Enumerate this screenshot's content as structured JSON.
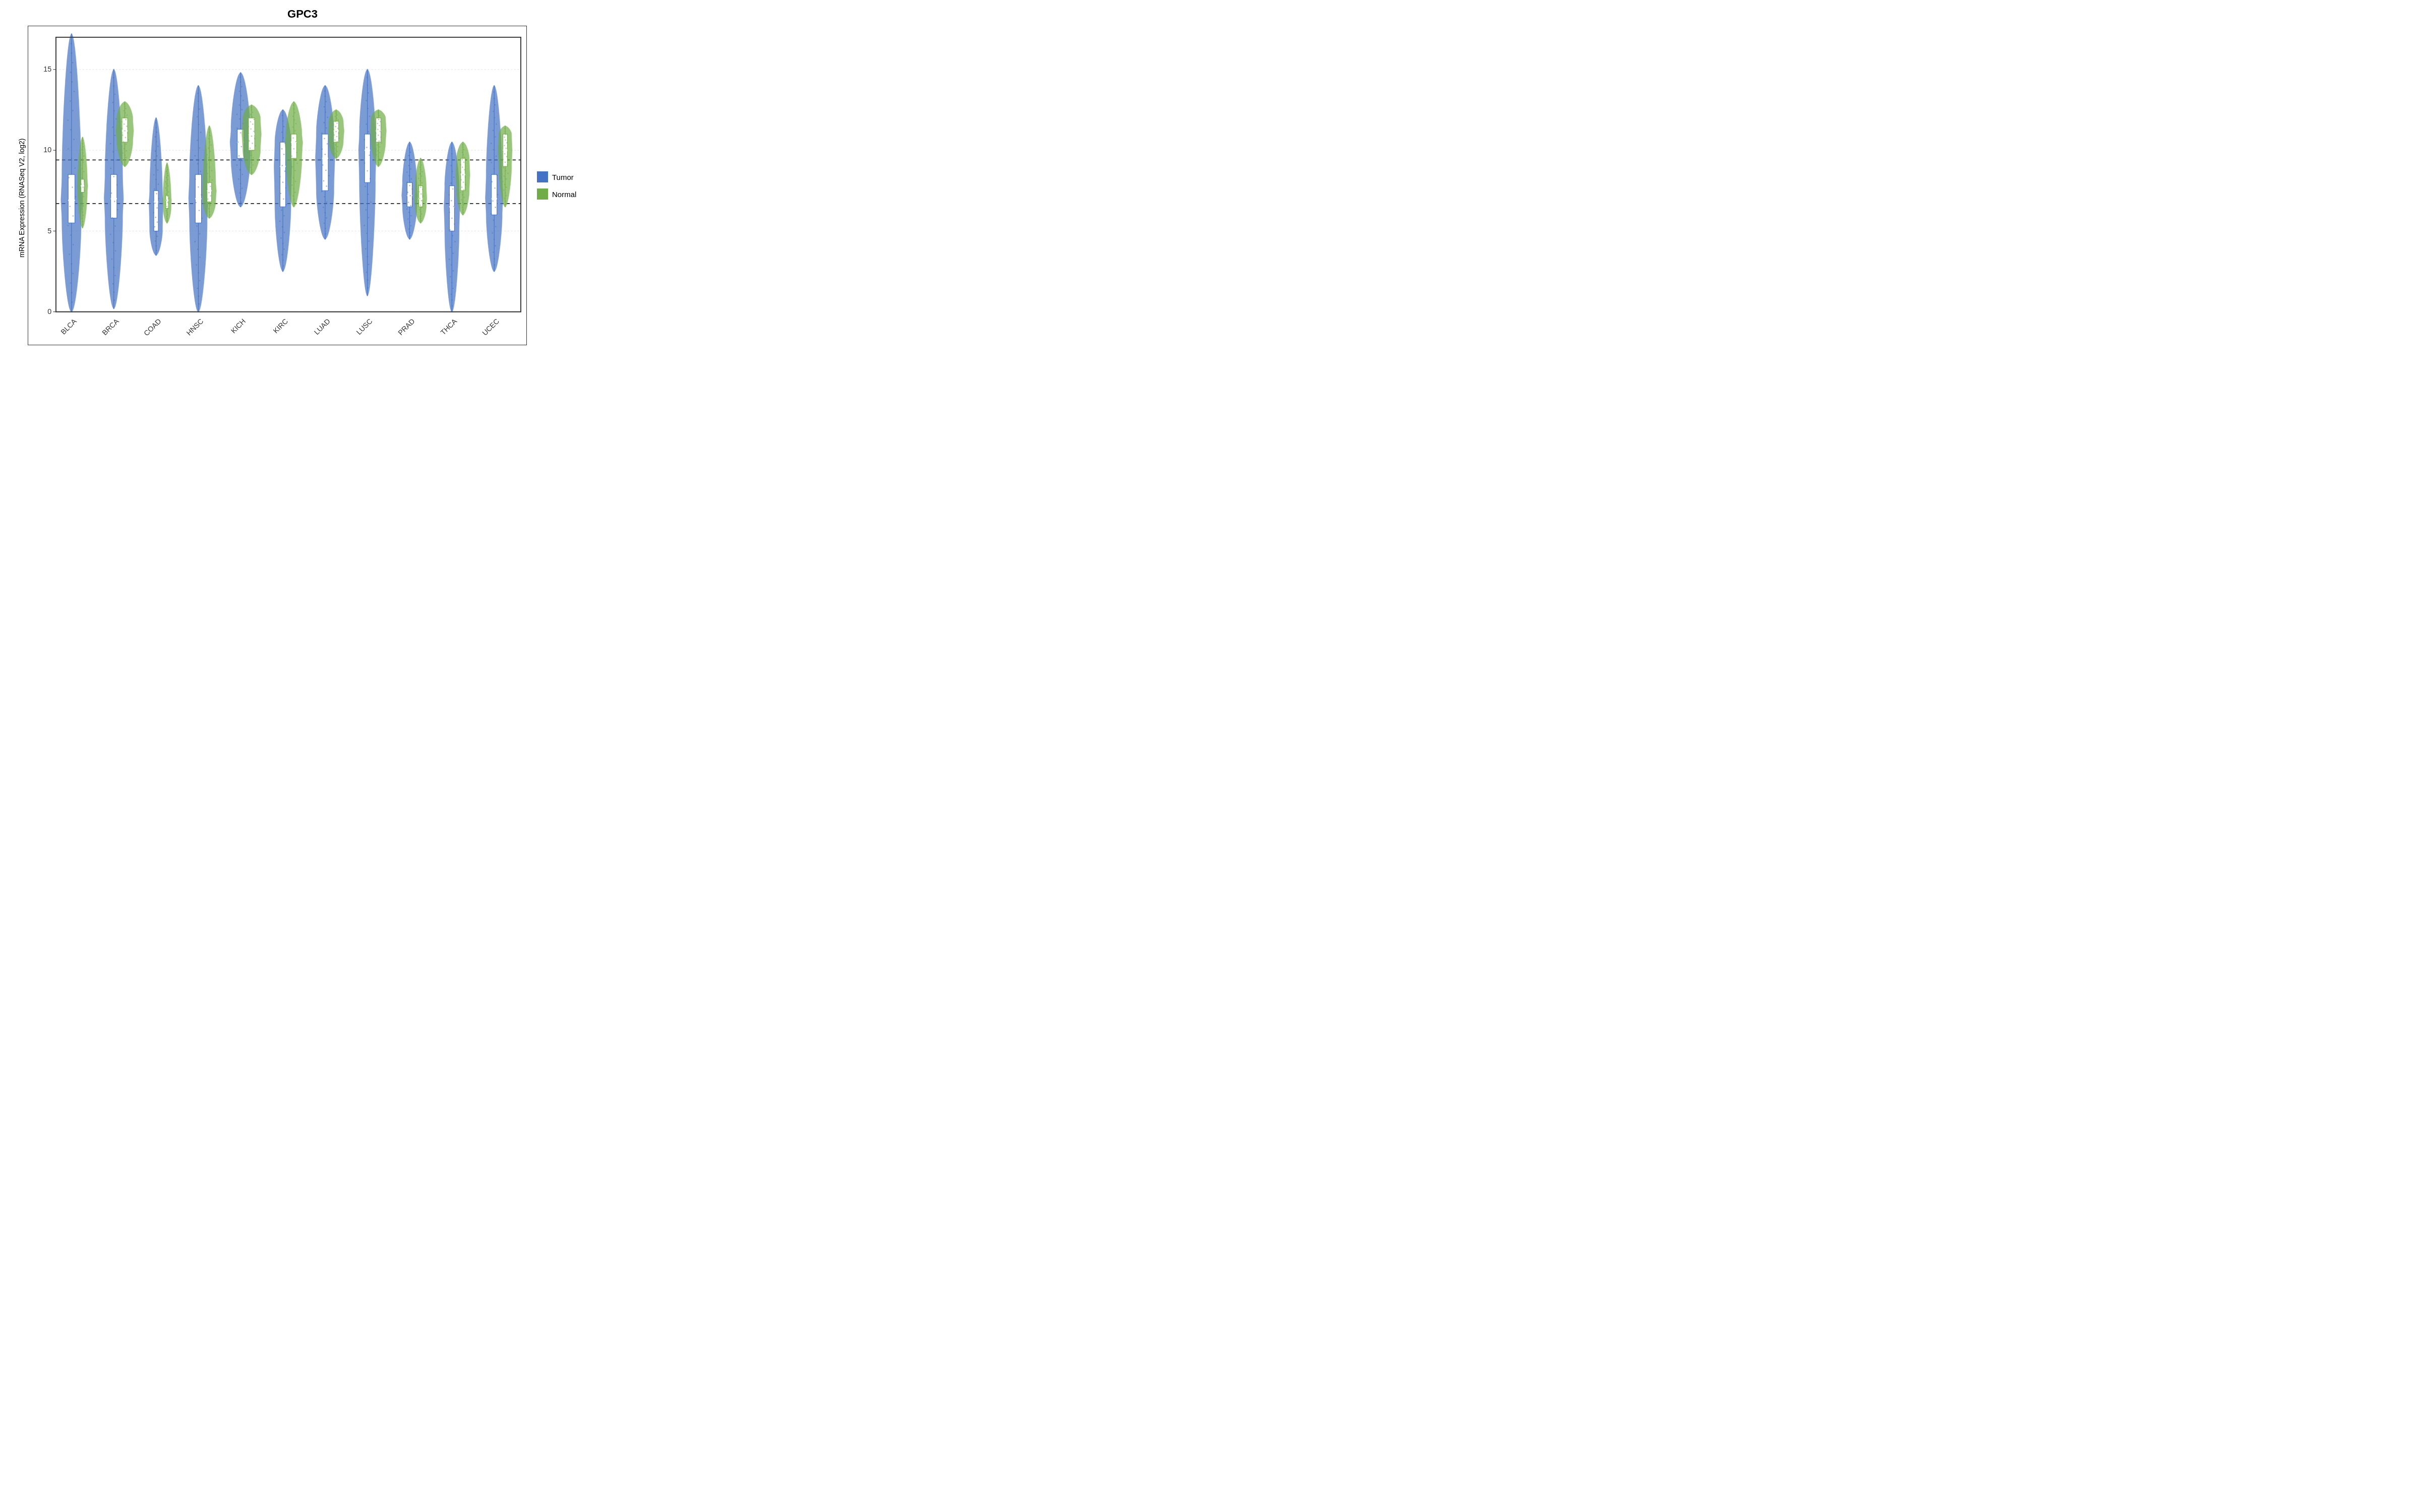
{
  "title": "GPC3",
  "yAxisLabel": "mRNA Expression (RNASeq V2, log2)",
  "yTicks": [
    0,
    5,
    10,
    15
  ],
  "dottedLines": [
    6.7,
    9.4
  ],
  "legend": {
    "items": [
      {
        "label": "Tumor",
        "color": "#4472C4"
      },
      {
        "label": "Normal",
        "color": "#70AD47"
      }
    ]
  },
  "cancerTypes": [
    "BLCA",
    "BRCA",
    "COAD",
    "HNSC",
    "KICH",
    "KIRC",
    "LUAD",
    "LUSC",
    "PRAD",
    "THCA",
    "UCEC"
  ],
  "violins": [
    {
      "type": "BLCA",
      "tumor": {
        "min": 0,
        "q1": 5.5,
        "median": 6.9,
        "q3": 8.5,
        "max": 17.2,
        "width": 0.6,
        "topOutliers": [
          13,
          12.5,
          12,
          11.5
        ],
        "bottomOutliers": [
          0,
          0.5,
          1,
          1.5,
          2,
          2.5
        ]
      },
      "normal": {
        "min": 5.2,
        "q1": 7.4,
        "median": 7.8,
        "q3": 8.2,
        "max": 10.8,
        "width": 0.3,
        "topOutliers": [],
        "bottomOutliers": []
      }
    },
    {
      "type": "BRCA",
      "tumor": {
        "min": 0.2,
        "q1": 5.8,
        "median": 7.0,
        "q3": 8.5,
        "max": 15.0,
        "width": 0.55,
        "topOutliers": [
          11,
          10.5,
          10
        ],
        "bottomOutliers": [
          0.2,
          0.5,
          1,
          1.5,
          2
        ]
      },
      "normal": {
        "min": 9.0,
        "q1": 10.5,
        "median": 11.2,
        "q3": 12.0,
        "max": 13.0,
        "width": 0.5,
        "topOutliers": [
          14,
          13.5
        ],
        "bottomOutliers": [
          8.5,
          8.8
        ]
      }
    },
    {
      "type": "COAD",
      "tumor": {
        "min": 3.5,
        "q1": 5.0,
        "median": 6.8,
        "q3": 7.5,
        "max": 12.0,
        "width": 0.4,
        "topOutliers": [],
        "bottomOutliers": []
      },
      "normal": {
        "min": 5.5,
        "q1": 6.4,
        "median": 6.9,
        "q3": 7.2,
        "max": 9.2,
        "width": 0.25,
        "topOutliers": [],
        "bottomOutliers": []
      }
    },
    {
      "type": "HNSC",
      "tumor": {
        "min": 0,
        "q1": 5.5,
        "median": 7.0,
        "q3": 8.5,
        "max": 14.0,
        "width": 0.55,
        "topOutliers": [],
        "bottomOutliers": [
          0,
          0.5,
          1
        ]
      },
      "normal": {
        "min": 5.8,
        "q1": 6.8,
        "median": 7.5,
        "q3": 8.0,
        "max": 11.5,
        "width": 0.4,
        "topOutliers": [],
        "bottomOutliers": []
      }
    },
    {
      "type": "KICH",
      "tumor": {
        "min": 6.5,
        "q1": 9.5,
        "median": 10.5,
        "q3": 11.3,
        "max": 14.8,
        "width": 0.6,
        "topOutliers": [],
        "bottomOutliers": []
      },
      "normal": {
        "min": 8.5,
        "q1": 10.0,
        "median": 11.0,
        "q3": 12.0,
        "max": 12.8,
        "width": 0.55,
        "topOutliers": [],
        "bottomOutliers": []
      }
    },
    {
      "type": "KIRC",
      "tumor": {
        "min": 2.5,
        "q1": 6.5,
        "median": 9.0,
        "q3": 10.5,
        "max": 12.5,
        "width": 0.5,
        "topOutliers": [],
        "bottomOutliers": [
          2.5,
          3.0
        ]
      },
      "normal": {
        "min": 6.5,
        "q1": 9.5,
        "median": 10.5,
        "q3": 11.0,
        "max": 13.0,
        "width": 0.5,
        "topOutliers": [],
        "bottomOutliers": [
          6.2
        ]
      }
    },
    {
      "type": "LUAD",
      "tumor": {
        "min": 4.5,
        "q1": 7.5,
        "median": 9.5,
        "q3": 11.0,
        "max": 14.0,
        "width": 0.55,
        "topOutliers": [],
        "bottomOutliers": []
      },
      "normal": {
        "min": 9.5,
        "q1": 10.5,
        "median": 11.2,
        "q3": 11.8,
        "max": 12.5,
        "width": 0.45,
        "topOutliers": [],
        "bottomOutliers": []
      }
    },
    {
      "type": "LUSC",
      "tumor": {
        "min": 1.0,
        "q1": 8.0,
        "median": 10.0,
        "q3": 11.0,
        "max": 15.0,
        "width": 0.5,
        "topOutliers": [],
        "bottomOutliers": [
          0.8,
          1.2
        ]
      },
      "normal": {
        "min": 9.0,
        "q1": 10.5,
        "median": 11.2,
        "q3": 12.0,
        "max": 12.5,
        "width": 0.45,
        "topOutliers": [],
        "bottomOutliers": []
      }
    },
    {
      "type": "PRAD",
      "tumor": {
        "min": 4.5,
        "q1": 6.5,
        "median": 7.2,
        "q3": 8.0,
        "max": 10.5,
        "width": 0.45,
        "topOutliers": [],
        "bottomOutliers": []
      },
      "normal": {
        "min": 5.5,
        "q1": 6.5,
        "median": 7.0,
        "q3": 7.8,
        "max": 9.5,
        "width": 0.35,
        "topOutliers": [],
        "bottomOutliers": [
          5.2
        ]
      }
    },
    {
      "type": "THCA",
      "tumor": {
        "min": 0,
        "q1": 5.0,
        "median": 6.5,
        "q3": 7.8,
        "max": 10.5,
        "width": 0.45,
        "topOutliers": [],
        "bottomOutliers": [
          0,
          0.3,
          0.5
        ]
      },
      "normal": {
        "min": 6.0,
        "q1": 7.5,
        "median": 8.5,
        "q3": 9.5,
        "max": 10.5,
        "width": 0.4,
        "topOutliers": [],
        "bottomOutliers": []
      }
    },
    {
      "type": "UCEC",
      "tumor": {
        "min": 2.5,
        "q1": 6.0,
        "median": 7.0,
        "q3": 8.5,
        "max": 14.0,
        "width": 0.5,
        "topOutliers": [],
        "bottomOutliers": []
      },
      "normal": {
        "min": 6.5,
        "q1": 9.0,
        "median": 10.0,
        "q3": 11.0,
        "max": 11.5,
        "width": 0.4,
        "topOutliers": [],
        "bottomOutliers": []
      }
    }
  ],
  "colors": {
    "tumor": "#4472C4",
    "normal": "#70AD47",
    "border": "#333333",
    "dottedLine": "#333333"
  }
}
